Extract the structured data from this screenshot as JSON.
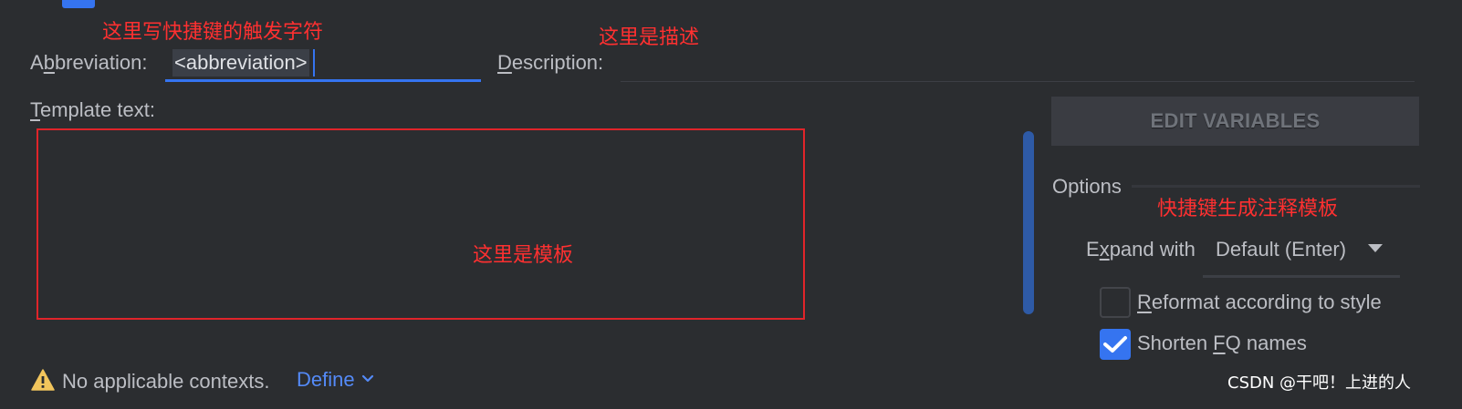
{
  "annotations": {
    "abbreviation_note": "这里写快捷键的触发字符",
    "description_note": "这里是描述",
    "template_note": "这里是模板",
    "options_note": "快捷键生成注释模板"
  },
  "form": {
    "abbreviation_label_pre": "A",
    "abbreviation_label_mnemonic": "b",
    "abbreviation_label_post": "breviation:",
    "abbreviation_value": "<abbreviation>",
    "description_label_mnemonic": "D",
    "description_label_post": "escription:",
    "description_value": "",
    "template_label_mnemonic": "T",
    "template_label_post": "emplate text:",
    "template_value": ""
  },
  "side": {
    "edit_variables_label": "EDIT VARIABLES",
    "options_title": "Options",
    "expand_label_pre": "E",
    "expand_label_mnemonic": "x",
    "expand_label_post": "pand with",
    "expand_value": "Default (Enter)",
    "reformat_mnemonic": "R",
    "reformat_post": "eformat according to style",
    "reformat_checked": false,
    "shorten_pre": "Shorten ",
    "shorten_mnemonic": "F",
    "shorten_post": "Q names",
    "shorten_checked": true
  },
  "footer": {
    "warning_text": "No applicable contexts.",
    "define_label": "Define",
    "watermark": "CSDN @干吧！上进的人"
  },
  "colors": {
    "background": "#2b2d30",
    "accent": "#3574f0",
    "annotation": "#ff3030",
    "warning": "#f2c55c"
  },
  "icons": {
    "warning": "warning-triangle-icon",
    "chevron": "chevron-down-icon",
    "dropdown": "dropdown-arrow-icon",
    "check": "checkmark-icon"
  }
}
